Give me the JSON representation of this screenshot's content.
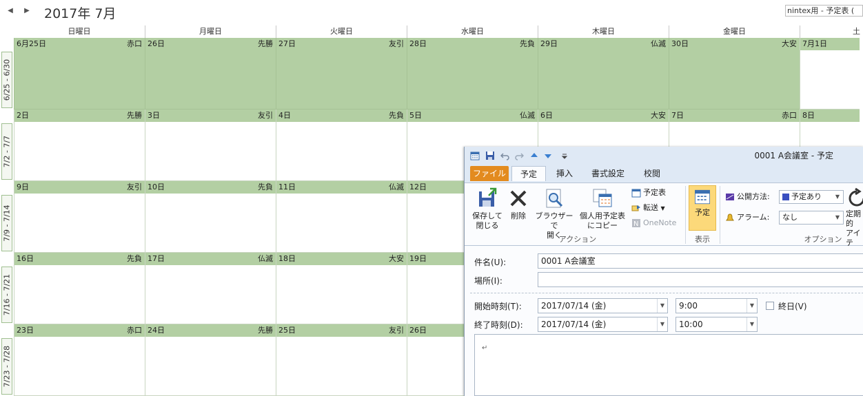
{
  "calendar": {
    "month_title": "2017年 7月",
    "search_value": "nintex用 - 予定表 (",
    "day_headers": [
      "日曜日",
      "月曜日",
      "火曜日",
      "水曜日",
      "木曜日",
      "金曜日",
      "土"
    ],
    "weeks": [
      {
        "label": "6/25 - 6/30",
        "days": [
          {
            "date": "6月25日",
            "rokuyo": "赤口",
            "highlight": true
          },
          {
            "date": "26日",
            "rokuyo": "先勝",
            "highlight": true
          },
          {
            "date": "27日",
            "rokuyo": "友引",
            "highlight": true
          },
          {
            "date": "28日",
            "rokuyo": "先負",
            "highlight": true
          },
          {
            "date": "29日",
            "rokuyo": "仏滅",
            "highlight": true
          },
          {
            "date": "30日",
            "rokuyo": "大安",
            "highlight": true
          },
          {
            "date": "7月1日",
            "rokuyo": "",
            "highlight": false
          }
        ]
      },
      {
        "label": "7/2 - 7/7",
        "days": [
          {
            "date": "2日",
            "rokuyo": "先勝"
          },
          {
            "date": "3日",
            "rokuyo": "友引"
          },
          {
            "date": "4日",
            "rokuyo": "先負"
          },
          {
            "date": "5日",
            "rokuyo": "仏滅"
          },
          {
            "date": "6日",
            "rokuyo": "大安"
          },
          {
            "date": "7日",
            "rokuyo": "赤口"
          },
          {
            "date": "8日",
            "rokuyo": ""
          }
        ]
      },
      {
        "label": "7/9 - 7/14",
        "days": [
          {
            "date": "9日",
            "rokuyo": "友引"
          },
          {
            "date": "10日",
            "rokuyo": "先負"
          },
          {
            "date": "11日",
            "rokuyo": "仏滅"
          },
          {
            "date": "12日",
            "rokuyo": ""
          },
          {
            "date": "",
            "rokuyo": ""
          },
          {
            "date": "",
            "rokuyo": ""
          },
          {
            "date": "",
            "rokuyo": ""
          }
        ]
      },
      {
        "label": "7/16 - 7/21",
        "days": [
          {
            "date": "16日",
            "rokuyo": "先負"
          },
          {
            "date": "17日",
            "rokuyo": "仏滅"
          },
          {
            "date": "18日",
            "rokuyo": "大安"
          },
          {
            "date": "19日",
            "rokuyo": ""
          },
          {
            "date": "",
            "rokuyo": ""
          },
          {
            "date": "",
            "rokuyo": ""
          },
          {
            "date": "",
            "rokuyo": ""
          }
        ]
      },
      {
        "label": "7/23 - 7/28",
        "days": [
          {
            "date": "23日",
            "rokuyo": "赤口"
          },
          {
            "date": "24日",
            "rokuyo": "先勝"
          },
          {
            "date": "25日",
            "rokuyo": "友引"
          },
          {
            "date": "26日",
            "rokuyo": ""
          },
          {
            "date": "",
            "rokuyo": ""
          },
          {
            "date": "",
            "rokuyo": ""
          },
          {
            "date": "",
            "rokuyo": ""
          }
        ]
      }
    ]
  },
  "appointment": {
    "window_title": "0001 A会議室 - 予定",
    "tabs": {
      "file": "ファイル",
      "appointment": "予定",
      "insert": "挿入",
      "format": "書式設定",
      "review": "校閲"
    },
    "ribbon": {
      "save_close_1": "保存して",
      "save_close_2": "閉じる",
      "delete": "削除",
      "browser_1": "ブラウザーで",
      "browser_2": "開く",
      "copy_1": "個人用予定表",
      "copy_2": "にコピー",
      "calendar": "予定表",
      "forward": "転送",
      "onenote": "OneNote",
      "group_action": "アクション",
      "show_appt": "予定",
      "group_show": "表示",
      "show_as_label": "公開方法:",
      "show_as_value": "予定あり",
      "reminder_label": "アラーム:",
      "reminder_value": "なし",
      "recur_1": "定期的",
      "recur_2": "アイテ",
      "group_options": "オプション"
    },
    "form": {
      "subject_label": "件名(U):",
      "subject_value": "0001 A会議室",
      "location_label": "場所(I):",
      "location_value": "",
      "start_label": "開始時刻(T):",
      "start_date": "2017/07/14 (金)",
      "start_time": "9:00",
      "allday_label": "終日(V)",
      "end_label": "終了時刻(D):",
      "end_date": "2017/07/14 (金)",
      "end_time": "10:00",
      "body_mark": "↵"
    }
  },
  "colors": {
    "highlight": "#b3cfa3",
    "file_tab": "#e38b1f",
    "accent": "#3a6fb0"
  }
}
